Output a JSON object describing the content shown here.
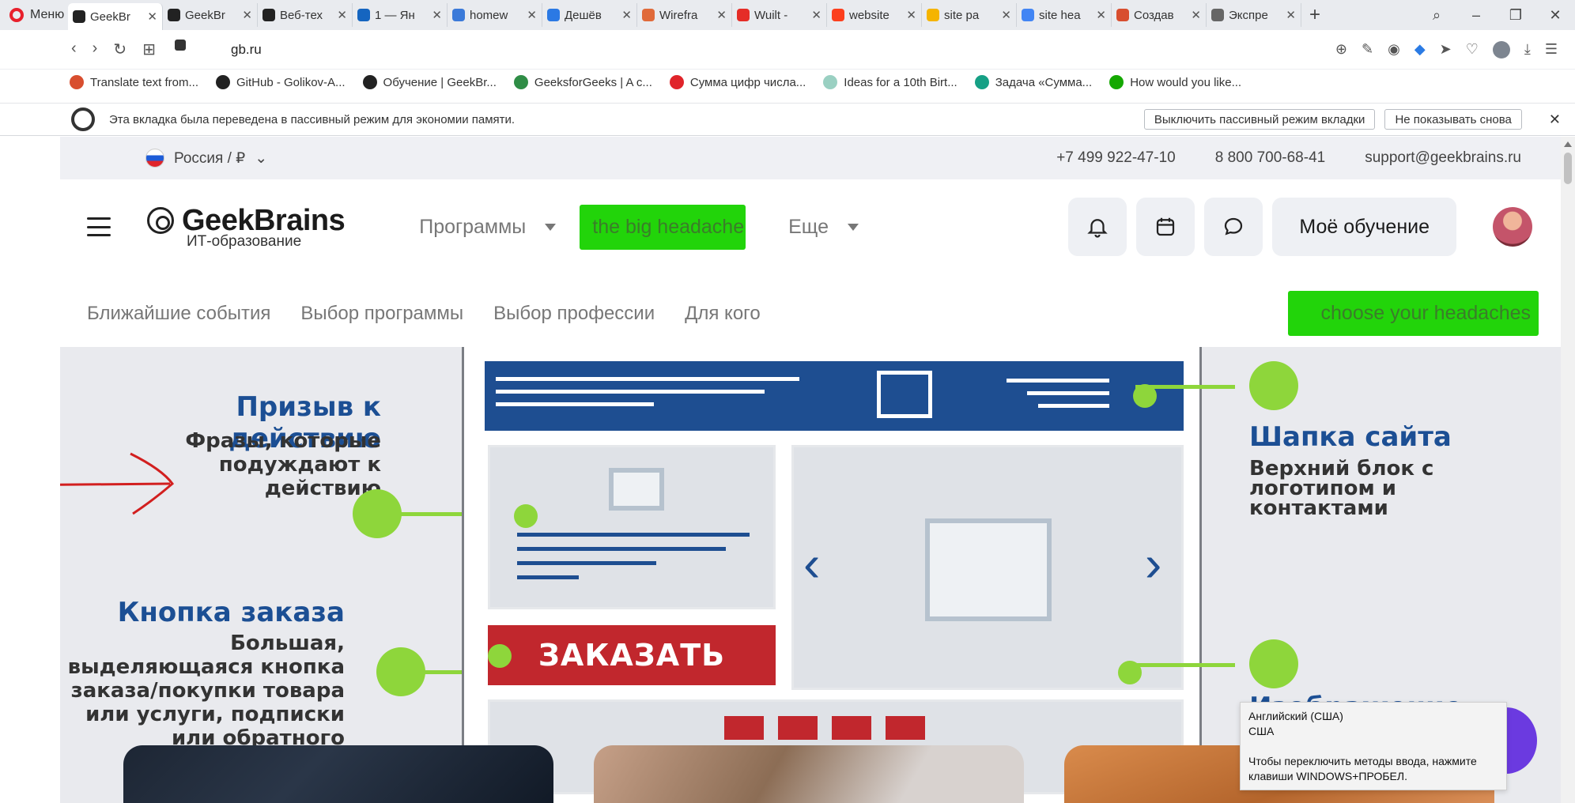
{
  "browser": {
    "menu_label": "Меню",
    "tabs": [
      {
        "label": "GeekBr",
        "color": "#222222",
        "active": true
      },
      {
        "label": "GeekBr",
        "color": "#222222"
      },
      {
        "label": "Веб-тех",
        "color": "#222222"
      },
      {
        "label": "1 — Ян",
        "color": "#1565c0"
      },
      {
        "label": "homew",
        "color": "#3b7ad9"
      },
      {
        "label": "Дешёв",
        "color": "#2b79e4"
      },
      {
        "label": "Wirefra",
        "color": "#e06a3a"
      },
      {
        "label": "Wuilt -",
        "color": "#e52d27"
      },
      {
        "label": "website",
        "color": "#fc3f1d"
      },
      {
        "label": "site pa",
        "color": "#f5b400"
      },
      {
        "label": "site hea",
        "color": "#4285f4"
      },
      {
        "label": "Создав",
        "color": "#d84e2f"
      },
      {
        "label": "Экспре",
        "color": "#666666"
      }
    ],
    "url": "gb.ru",
    "bookmarks": [
      {
        "label": "Translate text from...",
        "color": "#d84e2f"
      },
      {
        "label": "GitHub - Golikov-A...",
        "color": "#222222"
      },
      {
        "label": "Обучение | GeekBr...",
        "color": "#222222"
      },
      {
        "label": "GeeksforGeeks | A c...",
        "color": "#2f8d46"
      },
      {
        "label": "Сумма цифр числа...",
        "color": "#e0242a"
      },
      {
        "label": "Ideas for a 10th Birt...",
        "color": "#9ad0c2"
      },
      {
        "label": "Задача «Сумма...",
        "color": "#16a085"
      },
      {
        "label": "How would you like...",
        "color": "#14a800"
      }
    ],
    "infobar": {
      "message": "Эта вкладка была переведена в пассивный режим для экономии памяти.",
      "disable_button": "Выключить пассивный режим вкладки",
      "dont_show_button": "Не показывать снова"
    }
  },
  "site": {
    "region": "Россия / ₽",
    "phone1": "+7 499 922-47-10",
    "phone2": "8 800 700-68-41",
    "email": "support@geekbrains.ru",
    "logo_name": "GeekBrains",
    "logo_sub": "ИТ-образование",
    "nav": {
      "programs": "Программы",
      "highlight": "the big headache",
      "more": "Еще"
    },
    "learn_button": "Моё обучение",
    "subnav": [
      "Ближайшие события",
      "Выбор программы",
      "Выбор профессии",
      "Для кого"
    ],
    "subnav_highlight": "choose your headaches",
    "accent_green": "#22d40a"
  },
  "banner": {
    "cta_title": "Призыв к действию",
    "cta_text": "Фразы, которые подуждают к действию",
    "order_title": "Кнопка заказа",
    "order_text": "Большая, выделяющаяся кнопка заказа/покупки товара или услуги, подписки или обратного",
    "header_title": "Шапка сайта",
    "header_text": "Верхний блок с логотипом и контактами",
    "image_title": "Изображение",
    "order_button": "ЗАКАЗАТЬ"
  },
  "tooltip": {
    "lang": "Английский (США)",
    "country": "США",
    "hint": "Чтобы переключить методы ввода, нажмите клавиши WINDOWS+ПРОБЕЛ."
  }
}
